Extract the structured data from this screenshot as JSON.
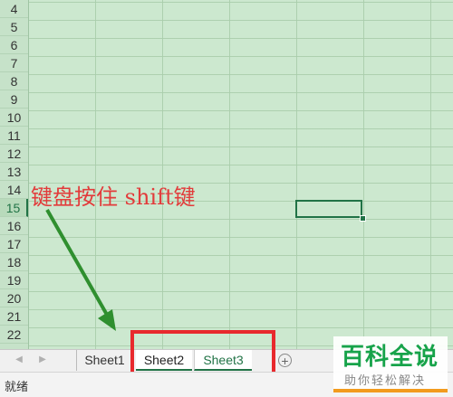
{
  "spreadsheet": {
    "row_numbers": [
      "4",
      "5",
      "6",
      "7",
      "8",
      "9",
      "10",
      "11",
      "12",
      "13",
      "14",
      "15",
      "16",
      "17",
      "18",
      "19",
      "20",
      "21",
      "22"
    ],
    "active_row": "15"
  },
  "annotation": {
    "text": "键盘按住 shift键",
    "color": "#e23b3b"
  },
  "tabs": {
    "items": [
      "Sheet1",
      "Sheet2",
      "Sheet3"
    ],
    "selected": [
      "Sheet2",
      "Sheet3"
    ],
    "add_icon": "plus-circle-icon",
    "highlight_color": "#e8292d"
  },
  "status_bar": {
    "text": "就绪"
  },
  "watermark": {
    "title": "百科全说",
    "subtitle": "助你轻松解决"
  },
  "colors": {
    "sheet_background": "#cce8cf",
    "accent": "#217346"
  }
}
